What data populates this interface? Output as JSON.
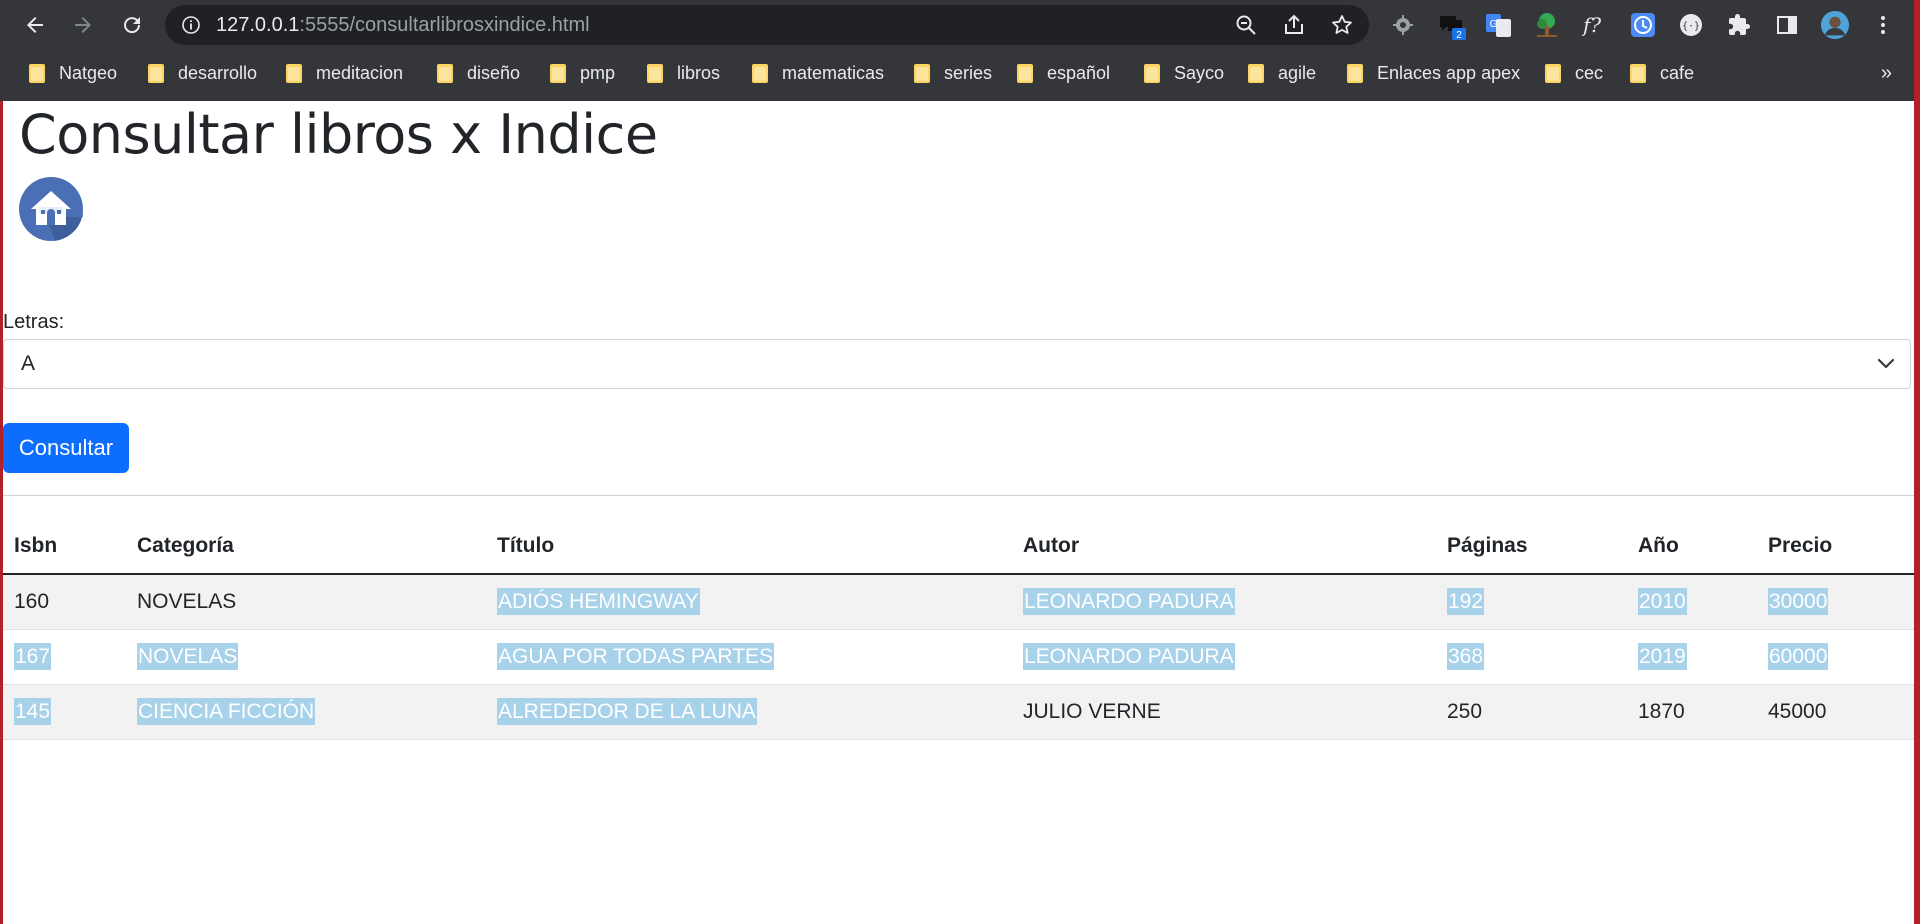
{
  "browser": {
    "url_host": "127.0.0.1",
    "url_rest": ":5555/consultarlibrosxindice.html",
    "extension_badge": "2",
    "bookmarks": [
      "Natgeo",
      "desarrollo",
      "meditacion",
      "diseño",
      "pmp",
      "libros",
      "matematicas",
      "series",
      "español",
      "Sayco",
      "agile",
      "Enlaces app apex",
      "cec",
      "cafe"
    ],
    "bookmarks_more": "»"
  },
  "page": {
    "title": "Consultar libros x Indice",
    "home_icon": "home-icon",
    "letters_label": "Letras:",
    "letters_value": "A",
    "submit_label": "Consultar"
  },
  "table": {
    "headers": [
      "Isbn",
      "Categoría",
      "Título",
      "Autor",
      "Páginas",
      "Año",
      "Precio"
    ],
    "rows": [
      [
        "160",
        "NOVELAS",
        "ADIÓS HEMINGWAY",
        "LEONARDO PADURA",
        "192",
        "2010",
        "30000"
      ],
      [
        "167",
        "NOVELAS",
        "AGUA POR TODAS PARTES",
        "LEONARDO PADURA",
        "368",
        "2019",
        "60000"
      ],
      [
        "145",
        "CIENCIA FICCIÓN",
        "ALREDEDOR DE LA LUNA",
        "JULIO VERNE",
        "250",
        "1870",
        "45000"
      ]
    ]
  },
  "colors": {
    "primary_button": "#0d6efd",
    "selection": "#a8d1ea",
    "chrome_bg": "#35363a"
  }
}
